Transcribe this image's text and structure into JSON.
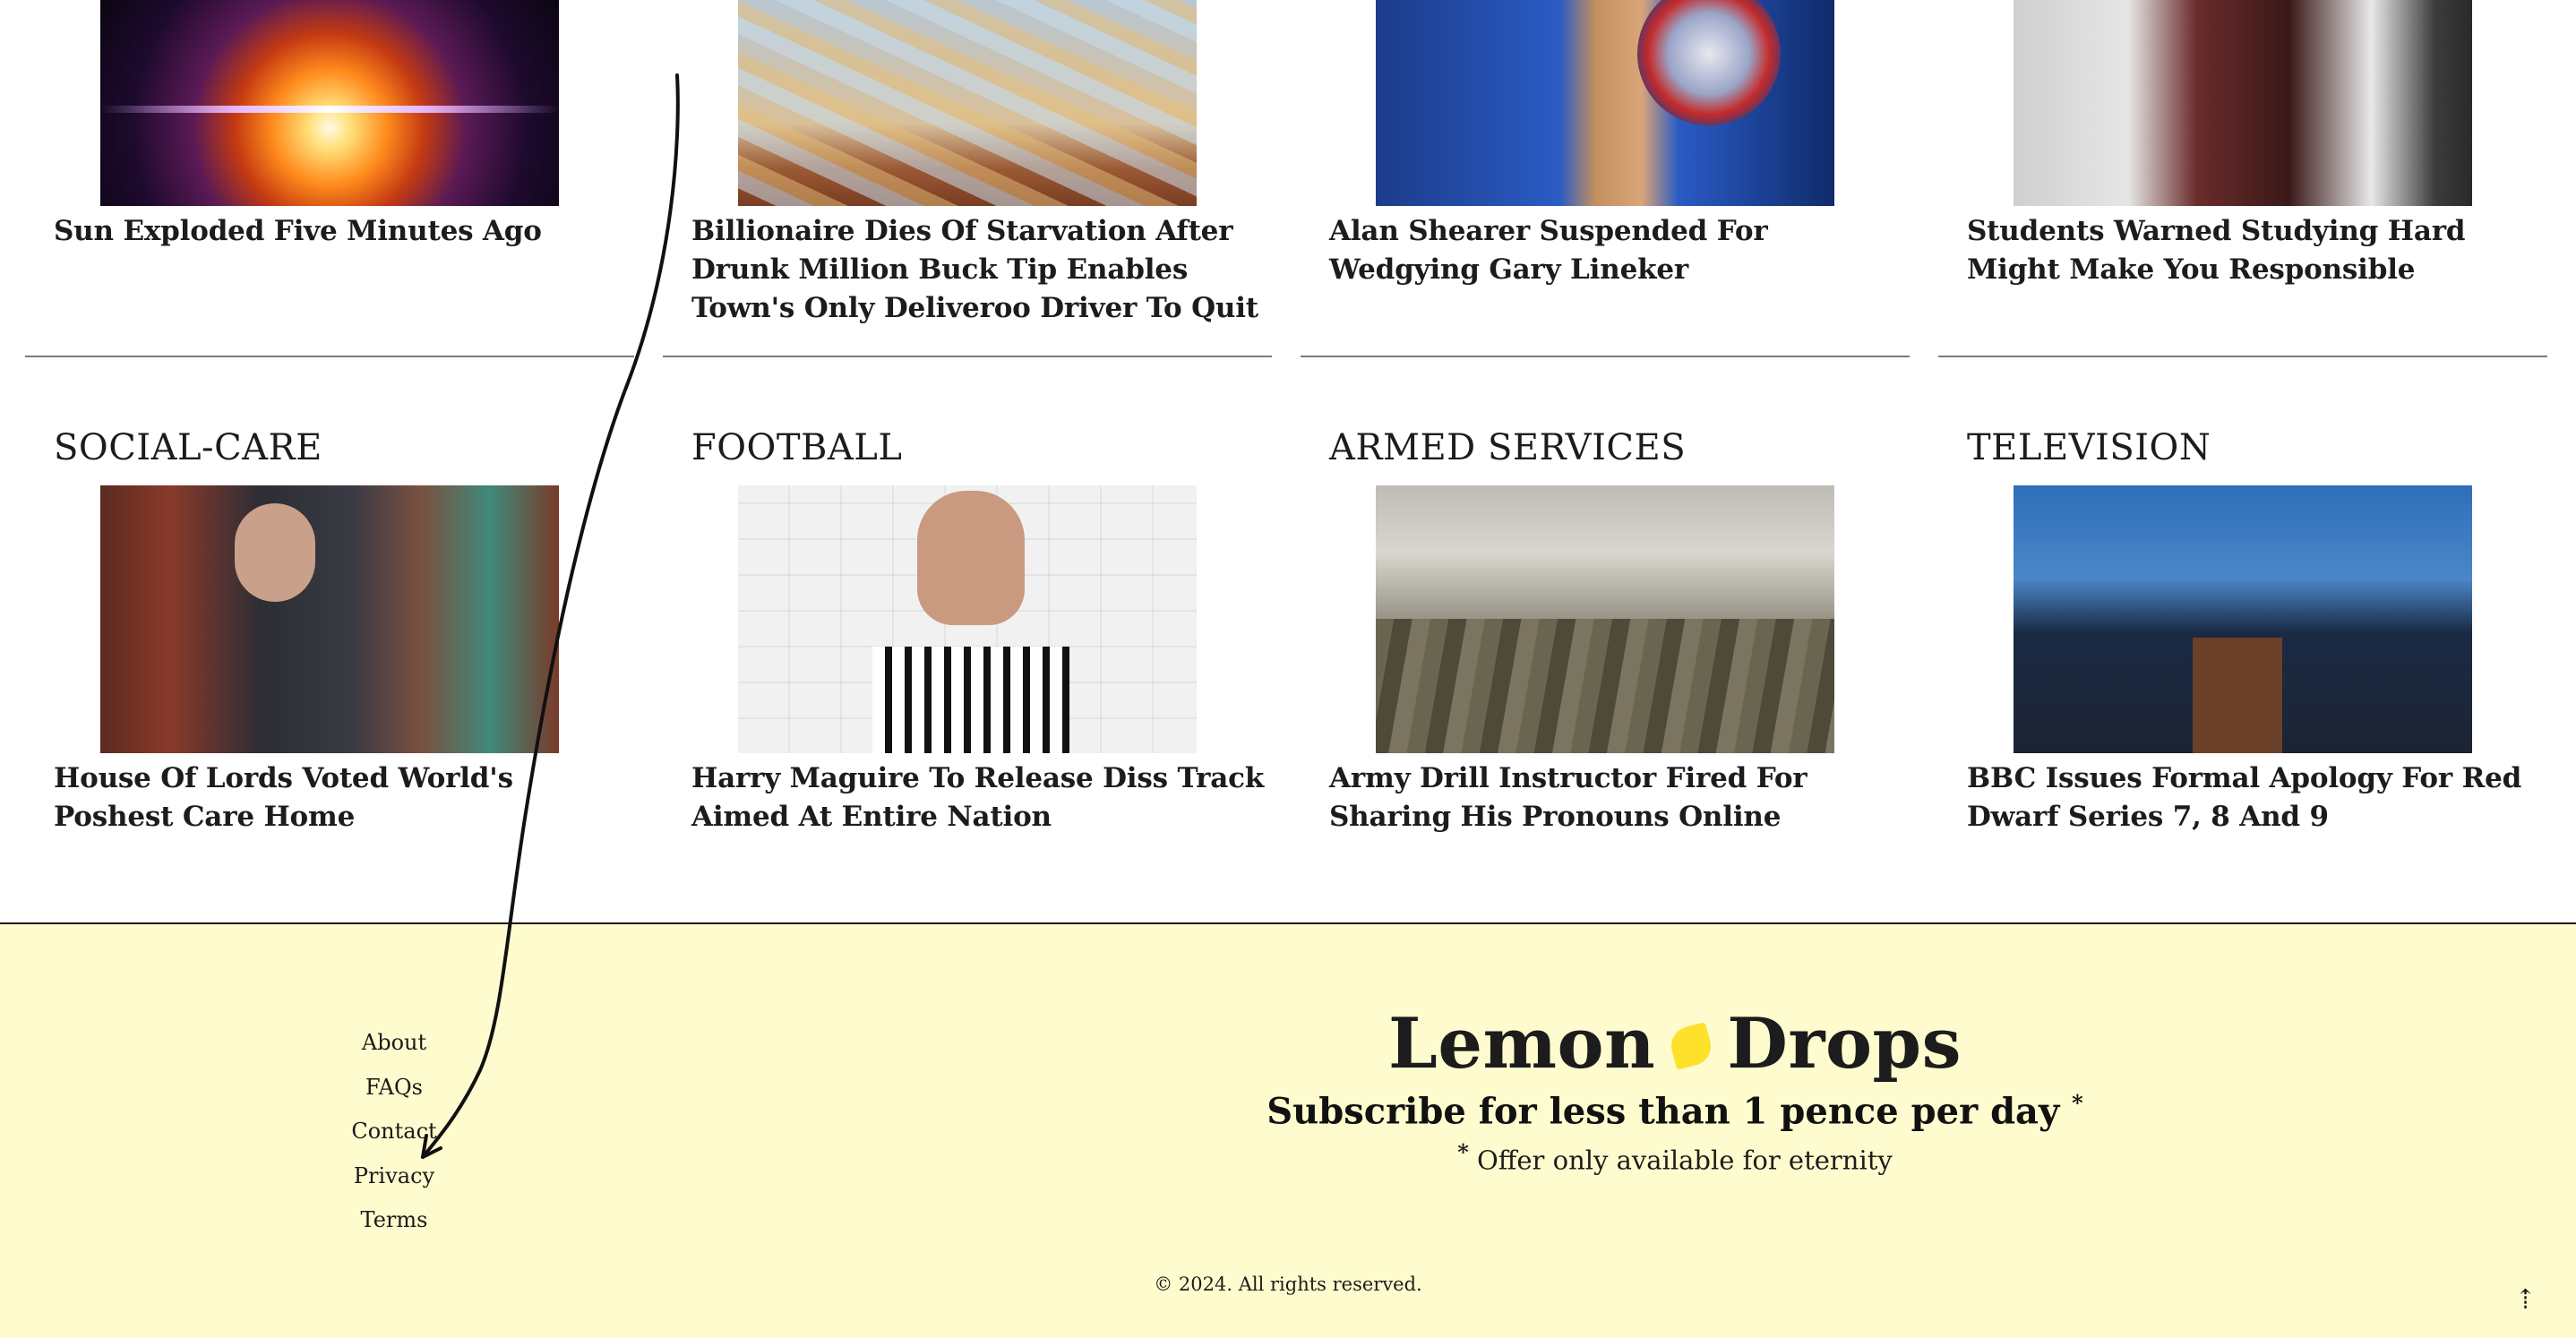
{
  "top_row": [
    {
      "headline": "Sun Exploded Five Minutes Ago",
      "image": "exploding-sun"
    },
    {
      "headline": "Billionaire Dies Of Starvation After Drunk Million Buck Tip Enables Town's Only Deliveroo Driver To Quit",
      "image": "pile-of-letters"
    },
    {
      "headline": "Alan Shearer Suspended For Wedgying Gary Lineker",
      "image": "tv-pundit"
    },
    {
      "headline": "Students Warned Studying Hard Might Make You Responsible",
      "image": "stressed-student"
    }
  ],
  "sections": [
    {
      "title": "SOCIAL-CARE",
      "headline": "House Of Lords Voted World's Poshest Care Home",
      "image": "house-of-lords"
    },
    {
      "title": "FOOTBALL",
      "headline": "Harry Maguire To Release Diss Track Aimed At Entire Nation",
      "image": "football-interview"
    },
    {
      "title": "ARMED SERVICES",
      "headline": "Army Drill Instructor Fired For Sharing His Pronouns Online",
      "image": "drill-instructor"
    },
    {
      "title": "TELEVISION",
      "headline": "BBC Issues Formal Apology For Red Dwarf Series 7, 8 And 9",
      "image": "un-podium"
    }
  ],
  "footer": {
    "links": [
      "About",
      "FAQs",
      "Contact",
      "Privacy",
      "Terms"
    ],
    "brand_left": "Lemon",
    "brand_right": "Drops",
    "brand_icon": "lemon-icon",
    "subscribe": "Subscribe for less than 1 pence per day",
    "subscribe_mark": "*",
    "offer_mark": "*",
    "offer": "Offer only available for eternity",
    "copyright": "© 2024. All rights reserved.",
    "to_top": "⇡"
  },
  "colors": {
    "footer_bg": "#fefcce",
    "lemon": "#fde12a",
    "divider": "#7a7a7a"
  }
}
